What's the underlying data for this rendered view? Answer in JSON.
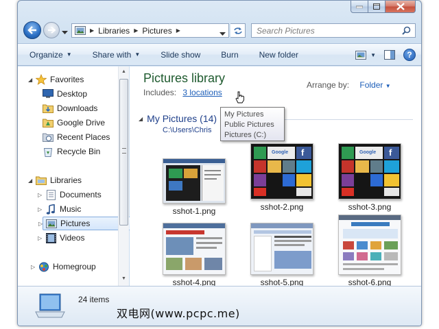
{
  "window": {
    "caption_buttons": [
      "minimize",
      "maximize",
      "close"
    ]
  },
  "address_bar": {
    "crumbs": [
      "Libraries",
      "Pictures"
    ],
    "search_placeholder": "Search Pictures"
  },
  "toolbar": {
    "organize": "Organize",
    "share_with": "Share with",
    "slide_show": "Slide show",
    "burn": "Burn",
    "new_folder": "New folder",
    "help": "?"
  },
  "sidebar": {
    "favorites_header": "Favorites",
    "favorites": [
      {
        "label": "Desktop",
        "icon": "desktop-icon"
      },
      {
        "label": "Downloads",
        "icon": "downloads-folder-icon"
      },
      {
        "label": "Google Drive",
        "icon": "google-drive-folder-icon"
      },
      {
        "label": "Recent Places",
        "icon": "recent-places-icon"
      },
      {
        "label": "Recycle Bin",
        "icon": "recycle-bin-icon"
      }
    ],
    "libraries_header": "Libraries",
    "libraries": [
      {
        "label": "Documents",
        "icon": "documents-icon"
      },
      {
        "label": "Music",
        "icon": "music-icon"
      },
      {
        "label": "Pictures",
        "icon": "pictures-icon",
        "selected": true
      },
      {
        "label": "Videos",
        "icon": "videos-icon"
      }
    ],
    "homegroup": "Homegroup"
  },
  "content": {
    "title": "Pictures library",
    "includes_label": "Includes:",
    "includes_link": "3 locations",
    "arrange_label": "Arrange by:",
    "arrange_value": "Folder",
    "group_name": "My Pictures (14)",
    "group_path": "C:\\Users\\Chris",
    "tooltip_lines": [
      "My Pictures",
      "Public Pictures",
      "Pictures (C:)"
    ],
    "files": [
      {
        "name": "sshot-1.png"
      },
      {
        "name": "sshot-2.png"
      },
      {
        "name": "sshot-3.png"
      },
      {
        "name": "sshot-4.png"
      },
      {
        "name": "sshot-5.png"
      },
      {
        "name": "sshot-6.png"
      }
    ]
  },
  "details": {
    "item_count": "24 items"
  },
  "watermark": "双电网(www.pcpc.me)",
  "colors": {
    "library_title": "#1e5a2e",
    "link": "#1b5db8",
    "group_header": "#1e3f8a"
  }
}
